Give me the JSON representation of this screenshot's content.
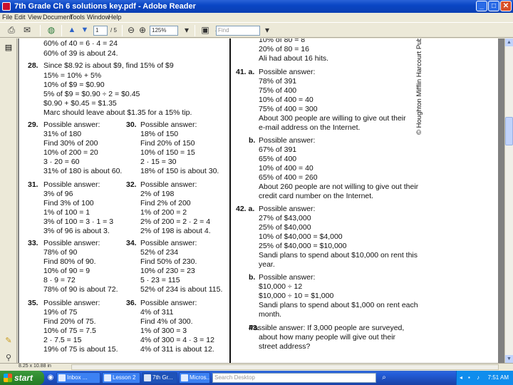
{
  "window": {
    "title": "7th Grade  Ch 6  solutions key.pdf - Adobe Reader",
    "minimize": "_",
    "maximize": "□",
    "close": "✕"
  },
  "menu": [
    "File",
    "Edit",
    "View",
    "Document",
    "Tools",
    "Window",
    "Help"
  ],
  "toolbar": {
    "page_current": "1",
    "page_total": "/ 5",
    "zoom": "125%",
    "find_placeholder": "Find"
  },
  "status": {
    "page_size": "8.25 x 10.88 in"
  },
  "left_col": [
    {
      "t": "60% of 40 = 6 · 4 = 24"
    },
    {
      "t": "60% of 39 is about 24."
    },
    {
      "num": "28.",
      "t": "Since $8.92 is about $9, find 15% of $9"
    },
    {
      "t": "15% = 10% + 5%"
    },
    {
      "t": "10% of $9 = $0.90"
    },
    {
      "t": "5% of $9 = $0.90 ÷ 2 = $0.45"
    },
    {
      "t": "$0.90 + $0.45 = $1.35"
    },
    {
      "t": "Marc should leave about $1.35 for a 15% tip."
    }
  ],
  "problems": [
    {
      "num": "29.",
      "lines": [
        "Possible answer:",
        "31% of 180",
        "Find 30% of 200",
        "10% of 200 = 20",
        "3 · 20 = 60",
        "31% of 180 is about 60."
      ]
    },
    {
      "num": "30.",
      "lines": [
        "Possible answer:",
        "18% of 150",
        "Find 20% of 150",
        "10% of 150 = 15",
        "2 · 15 = 30",
        "18% of 150 is about 30."
      ]
    },
    {
      "num": "31.",
      "lines": [
        "Possible answer:",
        "3% of 96",
        "Find 3% of 100",
        "1% of 100 = 1",
        "3% of 100 = 3 · 1 = 3",
        "3% of 96 is about 3."
      ]
    },
    {
      "num": "32.",
      "lines": [
        "Possible answer:",
        "2% of 198",
        "Find 2% of 200",
        "1% of 200 = 2",
        "2% of 200 = 2 · 2 = 4",
        "2% of 198 is about 4."
      ]
    },
    {
      "num": "33.",
      "lines": [
        "Possible answer:",
        "78% of 90",
        "Find 80% of 90.",
        "10% of 90 = 9",
        "8 · 9 = 72",
        "78% of 90 is about 72."
      ]
    },
    {
      "num": "34.",
      "lines": [
        "Possible answer:",
        "52% of 234",
        "Find 50% of 230.",
        "10% of 230 = 23",
        "5 · 23 = 115",
        "52% of 234 is about 115."
      ]
    },
    {
      "num": "35.",
      "lines": [
        "Possible answer:",
        "19% of 75",
        "Find 20% of 75.",
        "10% of 75 = 7.5",
        "2 · 7.5 = 15",
        "19% of 75 is about 15."
      ]
    },
    {
      "num": "36.",
      "lines": [
        "Possible answer:",
        "4% of 311",
        "Find 4% of 300.",
        "1% of 300 = 3",
        "4% of 300 = 4 · 3 = 12",
        "4% of 311 is about 12."
      ]
    }
  ],
  "right_col": [
    {
      "t": "10% of 80 = 8"
    },
    {
      "t": "20% of 80 = 16"
    },
    {
      "t": "Ali had about 16 hits."
    },
    {
      "num": "41. a.",
      "t": "Possible answer:"
    },
    {
      "t": "78% of 391"
    },
    {
      "t": "75% of 400"
    },
    {
      "t": "10% of 400 = 40"
    },
    {
      "t": "75% of 400 = 300"
    },
    {
      "t": "About 300 people are willing to give out their"
    },
    {
      "t": "e-mail address on the Internet."
    },
    {
      "num": "b.",
      "t": "Possible answer:"
    },
    {
      "t": "67% of 391"
    },
    {
      "t": "65% of 400"
    },
    {
      "t": "10% of 400 = 40"
    },
    {
      "t": "65% of 400 = 260"
    },
    {
      "t": "About 260 people are not willing to give out their"
    },
    {
      "t": "credit card number on the Internet."
    },
    {
      "num": "42. a.",
      "t": "Possible answer:"
    },
    {
      "t": "27% of $43,000"
    },
    {
      "t": "25% of $40,000"
    },
    {
      "t": "10% of $40,000 = $4,000"
    },
    {
      "t": "25% of $40,000 = $10,000"
    },
    {
      "t": "Sandi plans to spend about $10,000 on rent this"
    },
    {
      "t": "year."
    },
    {
      "num": "b.",
      "t": "Possible answer:"
    },
    {
      "t": "$10,000 ÷ 12"
    },
    {
      "t": "$10,000 ÷ 10 = $1,000"
    },
    {
      "t": "Sandi plans to spend about $1,000 on rent each"
    },
    {
      "t": "month."
    },
    {
      "num": "43.",
      "t": "Possible answer: If 3,000 people are surveyed,"
    },
    {
      "t": "about how many people will give out their"
    },
    {
      "t": "street address?"
    }
  ],
  "copyright": "© Houghton Mifflin Harcourt Publishing Company",
  "taskbar": {
    "start": "start",
    "buttons": [
      "Inbox ...",
      "Lesson 2",
      "7th Gr...",
      "Micros..."
    ],
    "search_placeholder": "Search Desktop",
    "clock": "7:51 AM"
  }
}
